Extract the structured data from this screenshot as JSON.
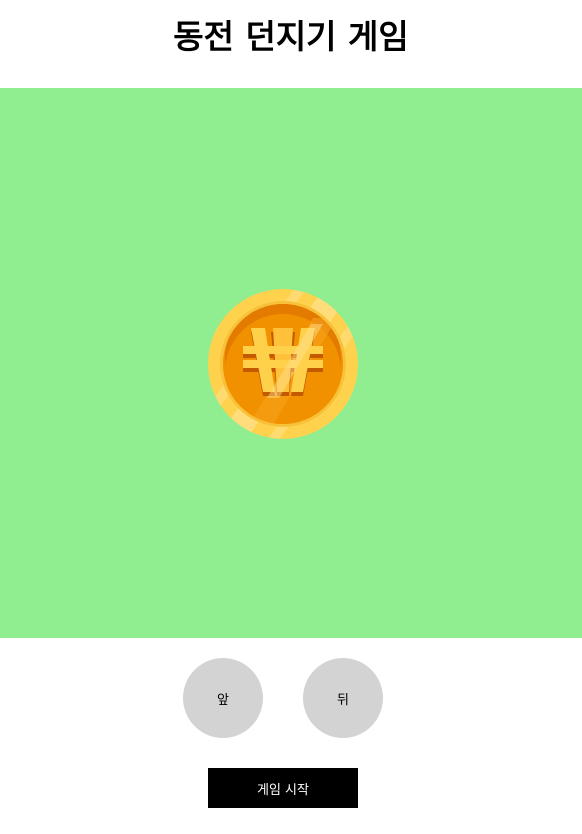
{
  "header": {
    "title": "동전 던지기 게임"
  },
  "game_area": {
    "background_color": "#90ee90",
    "coin": {
      "icon": "won-coin-icon",
      "symbol": "₩",
      "colors": {
        "rim": "#ffd24d",
        "face": "#f29100",
        "symbol": "#ffd04a"
      }
    }
  },
  "choices": {
    "front_label": "앞",
    "back_label": "뒤",
    "button_color": "#d3d3d3"
  },
  "start_button": {
    "label": "게임 시작",
    "background_color": "#000000",
    "text_color": "#ffffff"
  }
}
